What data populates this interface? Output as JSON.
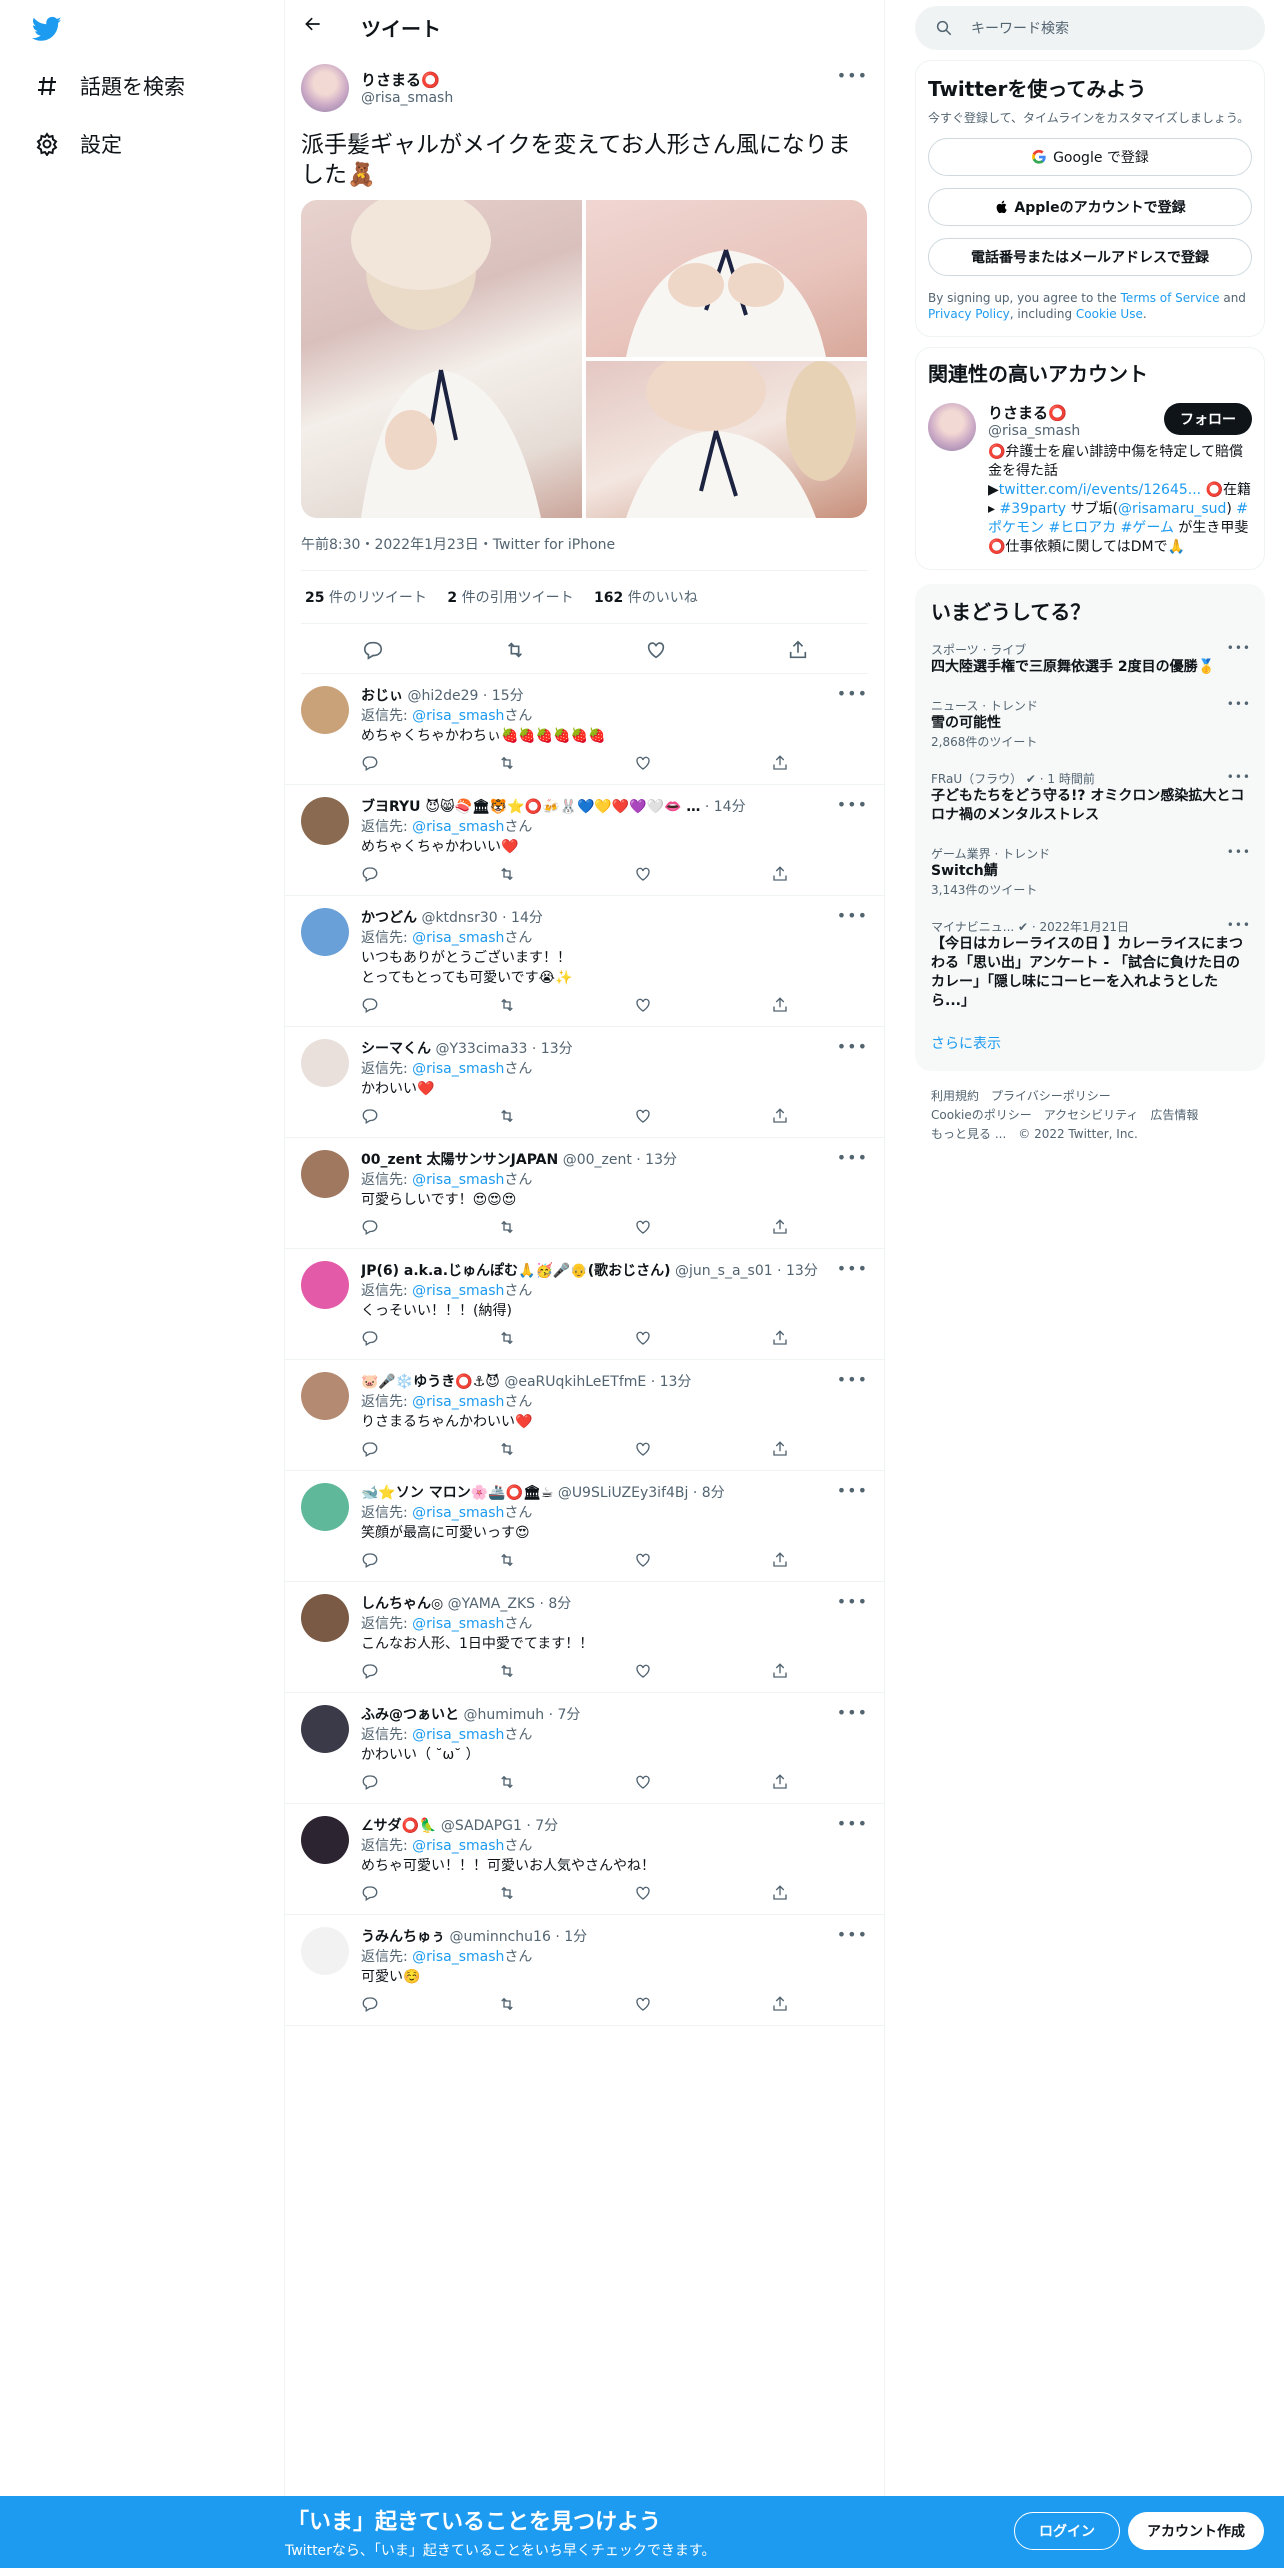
{
  "nav": {
    "explore": "話題を検索",
    "settings": "設定"
  },
  "header": {
    "title": "ツイート"
  },
  "main_tweet": {
    "name": "りさまる⭕",
    "handle": "@risa_smash",
    "text": "派手髪ギャルがメイクを変えてお人形さん風になりました🧸",
    "meta": "午前8:30・2022年1月23日・Twitter for iPhone",
    "stats": {
      "retweets_count": "25",
      "retweets_label": " 件のリツイート",
      "quotes_count": "2",
      "quotes_label": " 件の引用ツイート",
      "likes_count": "162",
      "likes_label": " 件のいいね"
    }
  },
  "reply_to_label": "返信先: ",
  "reply_to_handle": "@risa_smash",
  "reply_to_suffix": "さん",
  "replies": [
    {
      "name": "おじぃ",
      "handle": "@hi2de29",
      "time": "· 15分",
      "text": "めちゃくちゃかわちぃ🍓🍓🍓🍓🍓🍓",
      "color": "#c9a27a"
    },
    {
      "name": "ブヨRYU 😈😸🍣🏛🐯⭐⭕🍻🐰💙💛❤️💜🤍👄 …",
      "handle": "",
      "time": "· 14分",
      "text": "めちゃくちゃかわいい❤️",
      "color": "#8a6a50"
    },
    {
      "name": "かつどん",
      "handle": "@ktdnsr30",
      "time": "· 14分",
      "text": "いつもありがとうございます！！\nとってもとっても可愛いです😭✨",
      "color": "#6aa0d8"
    },
    {
      "name": "シーマくん",
      "handle": "@Y33cima33",
      "time": "· 13分",
      "text": "かわいい❤️",
      "color": "#e9e0dc"
    },
    {
      "name": "00_zent 太陽サンサンJAPAN",
      "handle": "@00_zent",
      "time": "· 13分",
      "text": "可愛らしいです！😍😍😍",
      "color": "#a07860"
    },
    {
      "name": "JP(6) a.k.a.じゅんぽむ🙏🥳🎤👴(歌おじさん)",
      "handle": "@jun_s_a_s01",
      "time": "· 13分",
      "text": "くっそいい！！！(納得)",
      "color": "#e35aa8"
    },
    {
      "name": "🐷🎤❄️ゆうき⭕⚓😈",
      "handle": "@eaRUqkihLeETfmE",
      "time": "· 13分",
      "text": "りさまるちゃんかわいい❤️",
      "color": "#b58a72"
    },
    {
      "name": "🐋⭐ソン マロン🌸🚢⭕🏛☕",
      "handle": "@U9SLiUZEy3if4Bj",
      "time": "· 8分",
      "text": "笑顔が最高に可愛いっす😍",
      "color": "#5fb89a"
    },
    {
      "name": "しんちゃん◎",
      "handle": "@YAMA_ZKS",
      "time": "· 8分",
      "text": "こんなお人形、1日中愛でてます！！",
      "color": "#7a5a44"
    },
    {
      "name": "ふみ@つぁいと",
      "handle": "@humimuh",
      "time": "· 7分",
      "text": "かわいい（ ˘ω˘ ）",
      "color": "#3a3a48"
    },
    {
      "name": "∠サダ⭕🦜",
      "handle": "@SADAPG1",
      "time": "· 7分",
      "text": "めちゃ可愛い！！！可愛いお人気やさんやね！",
      "color": "#2c2430"
    },
    {
      "name": "うみんちゅぅ",
      "handle": "@uminnchu16",
      "time": "· 1分",
      "text": "可愛い☺️",
      "color": "#f2f2f2"
    }
  ],
  "search": {
    "placeholder": "キーワード検索"
  },
  "signup_card": {
    "title": "Twitterを使ってみよう",
    "desc": "今すぐ登録して、タイムラインをカスタマイズしましょう。",
    "google": "Google で登録",
    "apple": "Appleのアカウントで登録",
    "phone": "電話番号またはメールアドレスで登録",
    "terms_prefix": "By signing up, you agree to the ",
    "terms_link": "Terms of Service",
    "terms_and": " and ",
    "privacy_link": "Privacy Policy",
    "including": ", including ",
    "cookie_link": "Cookie Use",
    "period": "."
  },
  "related": {
    "title": "関連性の高いアカウント",
    "name": "りさまる⭕",
    "handle": "@risa_smash",
    "follow": "フォロー",
    "bio_1": "⭕弁護士を雇い誹謗中傷を特定して賠償金を得た話▶",
    "bio_link": "twitter.com/i/events/12645...",
    "bio_2": " ⭕在籍▸ ",
    "bio_tag1": "#39party",
    "bio_3": " サブ垢(",
    "bio_mention": "@risamaru_sud",
    "bio_4": ") ",
    "bio_tag2": "#ポケモン",
    "bio_tag3": " #ヒロアカ",
    "bio_tag4": " #ゲーム",
    "bio_5": " が生き甲斐 ⭕仕事依頼に関してはDMで🙏"
  },
  "trends": {
    "title": "いまどうしてる？",
    "items": [
      {
        "ctx": "スポーツ · ライブ",
        "title": "四大陸選手権で三原舞依選手 2度目の優勝🥇",
        "count": ""
      },
      {
        "ctx": "ニュース · トレンド",
        "title": "雪の可能性",
        "count": "2,868件のツイート"
      },
      {
        "ctx": "FRaU（フラウ） ✔ · 1 時間前",
        "title": "子どもたちをどう守る!? オミクロン感染拡大とコロナ禍のメンタルストレス",
        "count": ""
      },
      {
        "ctx": "ゲーム業界 · トレンド",
        "title": "Switch鯖",
        "count": "3,143件のツイート"
      },
      {
        "ctx": "マイナビニュ... ✔ · 2022年1月21日",
        "title": "【今日はカレーライスの日 】カレーライスにまつわる「思い出」アンケート - 「試合に負けた日のカレー」「隠し味にコーヒーを入れようとしたら...」",
        "count": ""
      }
    ],
    "more": "さらに表示"
  },
  "footer": {
    "terms": "利用規約",
    "privacy": "プライバシーポリシー",
    "cookie": "Cookieのポリシー",
    "access": "アクセシビリティ",
    "ads": "広告情報",
    "more": "もっと見る ...",
    "copyright": "© 2022 Twitter, Inc."
  },
  "bottom_bar": {
    "headline": "「いま」起きていることを見つけよう",
    "sub": "Twitterなら、「いま」起きていることをいち早くチェックできます。",
    "login": "ログイン",
    "signup": "アカウント作成"
  },
  "colors": {
    "accent": "#1d9bf0",
    "text": "#0f1419",
    "muted": "#536471"
  }
}
